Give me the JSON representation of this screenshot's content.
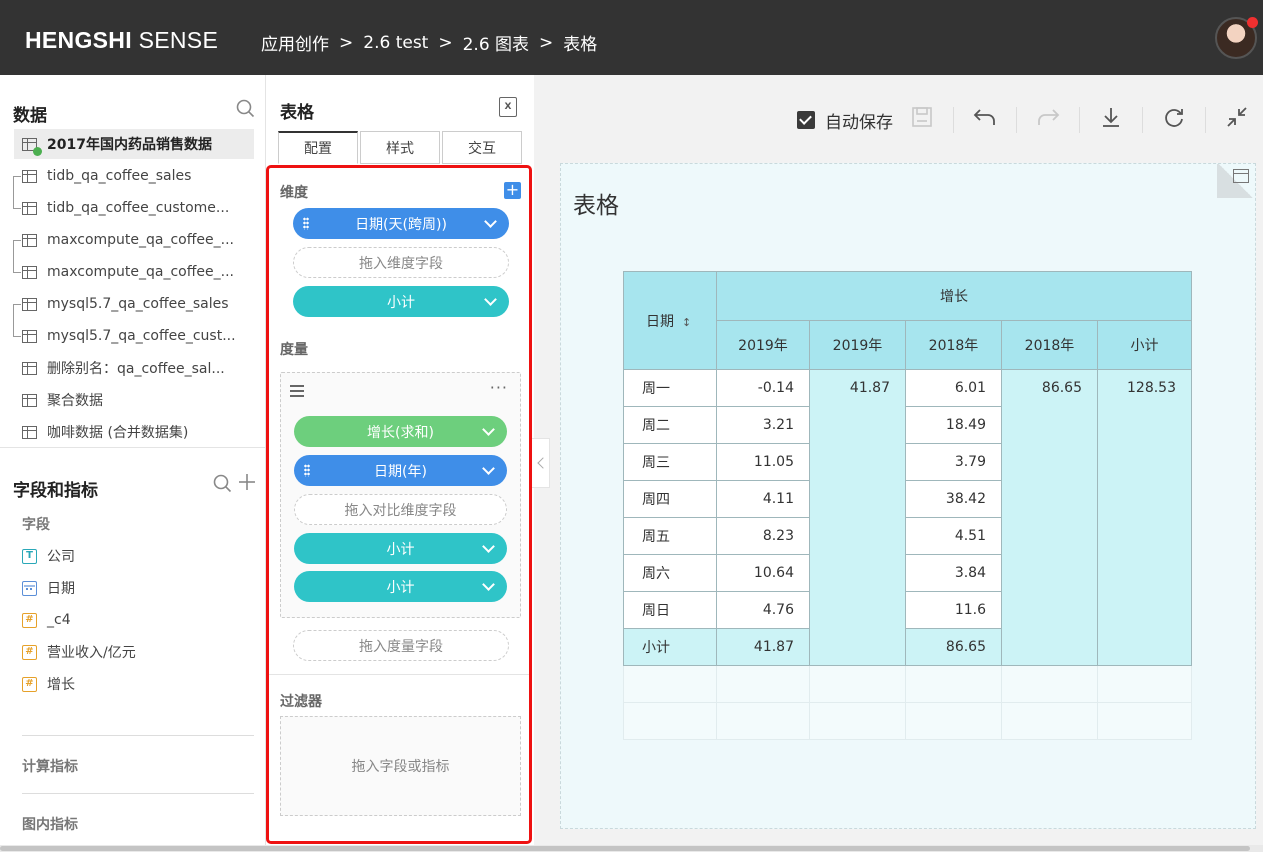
{
  "header": {
    "logo_bold": "HENGSHI",
    "logo_light": "SENSE",
    "breadcrumb": [
      "应用创作",
      "2.6 test",
      "2.6 图表",
      "表格"
    ],
    "separator": ">"
  },
  "data_panel": {
    "title": "数据",
    "datasets": [
      {
        "label": "2017年国内药品销售数据",
        "active": true
      },
      {
        "label": "tidb_qa_coffee_sales"
      },
      {
        "label": "tidb_qa_coffee_custome..."
      },
      {
        "label": "maxcompute_qa_coffee_..."
      },
      {
        "label": "maxcompute_qa_coffee_..."
      },
      {
        "label": "mysql5.7_qa_coffee_sales"
      },
      {
        "label": "mysql5.7_qa_coffee_cust..."
      },
      {
        "label": "删除别名：qa_coffee_sal..."
      },
      {
        "label": "聚合数据"
      },
      {
        "label": "咖啡数据 (合并数据集)"
      }
    ]
  },
  "fields_panel": {
    "title": "字段和指标",
    "fields_label": "字段",
    "fields": [
      {
        "type_icon": "T",
        "kind": "text",
        "label": "公司"
      },
      {
        "type_icon": "date",
        "kind": "date",
        "label": "日期"
      },
      {
        "type_icon": "#",
        "kind": "number",
        "label": "_c4"
      },
      {
        "type_icon": "#",
        "kind": "number",
        "label": "营业收入/亿元"
      },
      {
        "type_icon": "#",
        "kind": "number",
        "label": "增长"
      }
    ],
    "calc_label": "计算指标",
    "chart_label": "图内指标"
  },
  "config_panel": {
    "title": "表格",
    "tabs": [
      "配置",
      "样式",
      "交互"
    ],
    "active_tab": "配置",
    "dimension_label": "维度",
    "dimension_pill_1": "日期(天(跨周))",
    "dimension_drop": "拖入维度字段",
    "dimension_pill_2": "小计",
    "measure_label": "度量",
    "measure_pill_1": "增长(求和)",
    "measure_pill_2": "日期(年)",
    "compare_drop": "拖入对比维度字段",
    "measure_pill_3": "小计",
    "measure_pill_4": "小计",
    "measure_drop": "拖入度量字段",
    "filter_label": "过滤器",
    "filter_drop": "拖入字段或指标",
    "colors": {
      "blue": "#3f8ee8",
      "teal": "#2fc4c8",
      "green": "#6dcf7d",
      "highlight": "#ee1111"
    }
  },
  "toolbar": {
    "autosave_label": "自动保存",
    "autosave_checked": true,
    "icons": [
      "save-icon",
      "undo-icon",
      "redo-icon",
      "download-icon",
      "refresh-icon",
      "collapse-icon"
    ]
  },
  "chart": {
    "title": "表格",
    "corner_header": "日期",
    "group_header": "增长",
    "col_headers": [
      "2019年",
      "2019年",
      "2018年",
      "2018年",
      "小计"
    ],
    "rows": [
      {
        "label": "周一",
        "v2019": "-0.14",
        "v2018": "6.01"
      },
      {
        "label": "周二",
        "v2019": "3.21",
        "v2018": "18.49"
      },
      {
        "label": "周三",
        "v2019": "11.05",
        "v2018": "3.79"
      },
      {
        "label": "周四",
        "v2019": "4.11",
        "v2018": "38.42"
      },
      {
        "label": "周五",
        "v2019": "8.23",
        "v2018": "4.51"
      },
      {
        "label": "周六",
        "v2019": "10.64",
        "v2018": "3.84"
      },
      {
        "label": "周日",
        "v2019": "4.76",
        "v2018": "11.6"
      }
    ],
    "subtotal_2019": "41.87",
    "subtotal_2018": "86.65",
    "grand_total": "128.53",
    "total_row": {
      "label": "小计",
      "v2019": "41.87",
      "v2018": "86.65"
    }
  }
}
